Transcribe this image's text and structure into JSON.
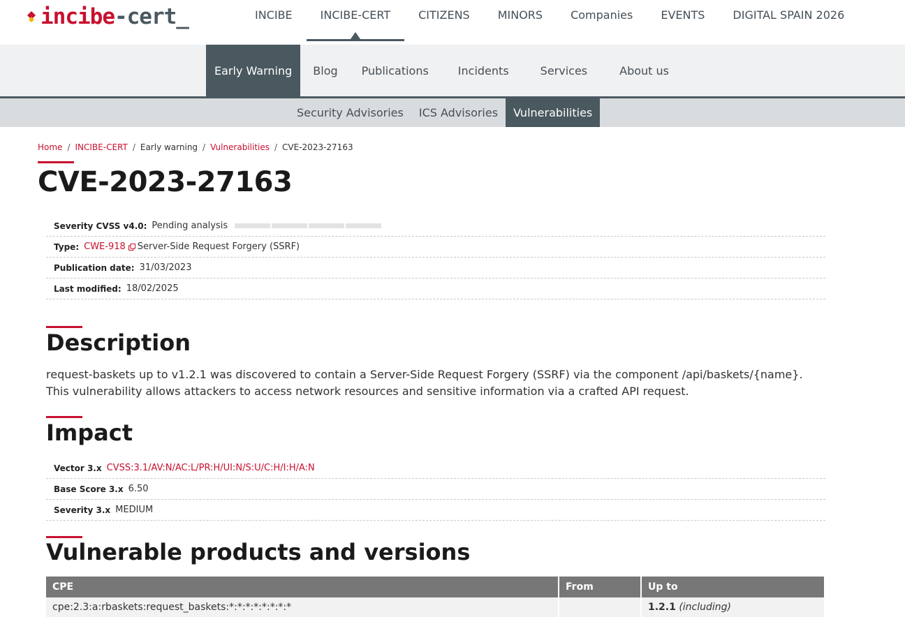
{
  "logo": {
    "part1": "incibe",
    "part2": "-cert_"
  },
  "main_nav": [
    "INCIBE",
    "INCIBE-CERT",
    "CITIZENS",
    "MINORS",
    "Companies",
    "EVENTS",
    "DIGITAL SPAIN 2026"
  ],
  "second_nav": [
    "Early Warning",
    "Blog",
    "Publications",
    "Incidents",
    "Services",
    "About us"
  ],
  "third_nav": [
    "Security Advisories",
    "ICS Advisories",
    "Vulnerabilities"
  ],
  "breadcrumb": [
    "Home",
    "INCIBE-CERT",
    "Early warning",
    "Vulnerabilities",
    "CVE-2023-27163"
  ],
  "title": "CVE-2023-27163",
  "meta": {
    "severity_label": "Severity CVSS v4.0:",
    "severity_value": "Pending analysis",
    "type_label": "Type:",
    "type_cwe": "CWE-918",
    "type_desc": "Server-Side Request Forgery (SSRF)",
    "pub_label": "Publication date:",
    "pub_value": "31/03/2023",
    "mod_label": "Last modified:",
    "mod_value": "18/02/2025"
  },
  "description": {
    "heading": "Description",
    "text": "request-baskets up to v1.2.1 was discovered to contain a Server-Side Request Forgery (SSRF) via the component /api/baskets/{name}. This vulnerability allows attackers to access network resources and sensitive information via a crafted API request."
  },
  "impact": {
    "heading": "Impact",
    "vector_label": "Vector 3.x",
    "vector_value": "CVSS:3.1/AV:N/AC:L/PR:H/UI:N/S:U/C:H/I:H/A:N",
    "score_label": "Base Score 3.x",
    "score_value": "6.50",
    "sev_label": "Severity 3.x",
    "sev_value": "MEDIUM"
  },
  "products": {
    "heading": "Vulnerable products and versions",
    "columns": [
      "CPE",
      "From",
      "Up to"
    ],
    "rows": [
      {
        "cpe": "cpe:2.3:a:rbaskets:request_baskets:*:*:*:*:*:*:*:*",
        "from": "",
        "upto": "1.2.1",
        "upto_note": "(including)"
      }
    ]
  },
  "colors": {
    "accent": "#c8102e",
    "nav_dark": "#4a5860"
  }
}
